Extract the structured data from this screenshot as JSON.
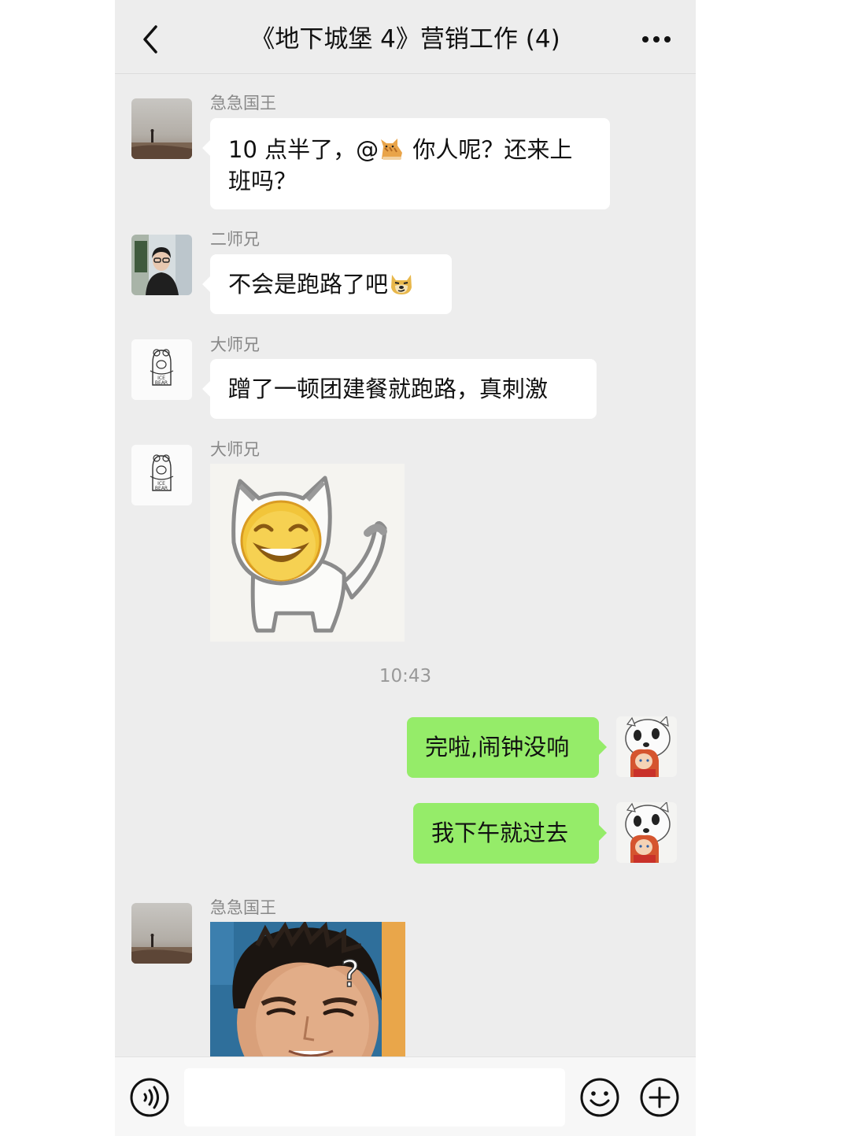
{
  "chat": {
    "title": "《地下城堡 4》营销工作 (4)",
    "back_icon": "chevron-left-icon",
    "more_icon": "more-dots-icon"
  },
  "messages": [
    {
      "sender": "急急国王",
      "text_before": "10 点半了，@",
      "text_after": " 你人呢？还来上班吗？",
      "emoji": "cat-emoji"
    },
    {
      "sender": "二师兄",
      "text": "不会是跑路了吧",
      "emoji": "doge-emoji"
    },
    {
      "sender": "大师兄",
      "text": "蹭了一顿团建餐就跑路，真刺激"
    },
    {
      "sender": "大师兄",
      "sticker": "smiling-cat-sticker"
    },
    {
      "timestamp": "10:43"
    },
    {
      "self": true,
      "text": "完啦,闹钟没响"
    },
    {
      "self": true,
      "text": "我下午就过去"
    },
    {
      "sender": "急急国王",
      "sticker": "confused-man-photo"
    }
  ],
  "input_bar": {
    "voice_icon": "voice-icon",
    "placeholder": "",
    "emoji_icon": "emoji-icon",
    "plus_icon": "plus-icon"
  },
  "colors": {
    "background": "#ededed",
    "self_bubble": "#95ec69",
    "other_bubble": "#ffffff"
  }
}
